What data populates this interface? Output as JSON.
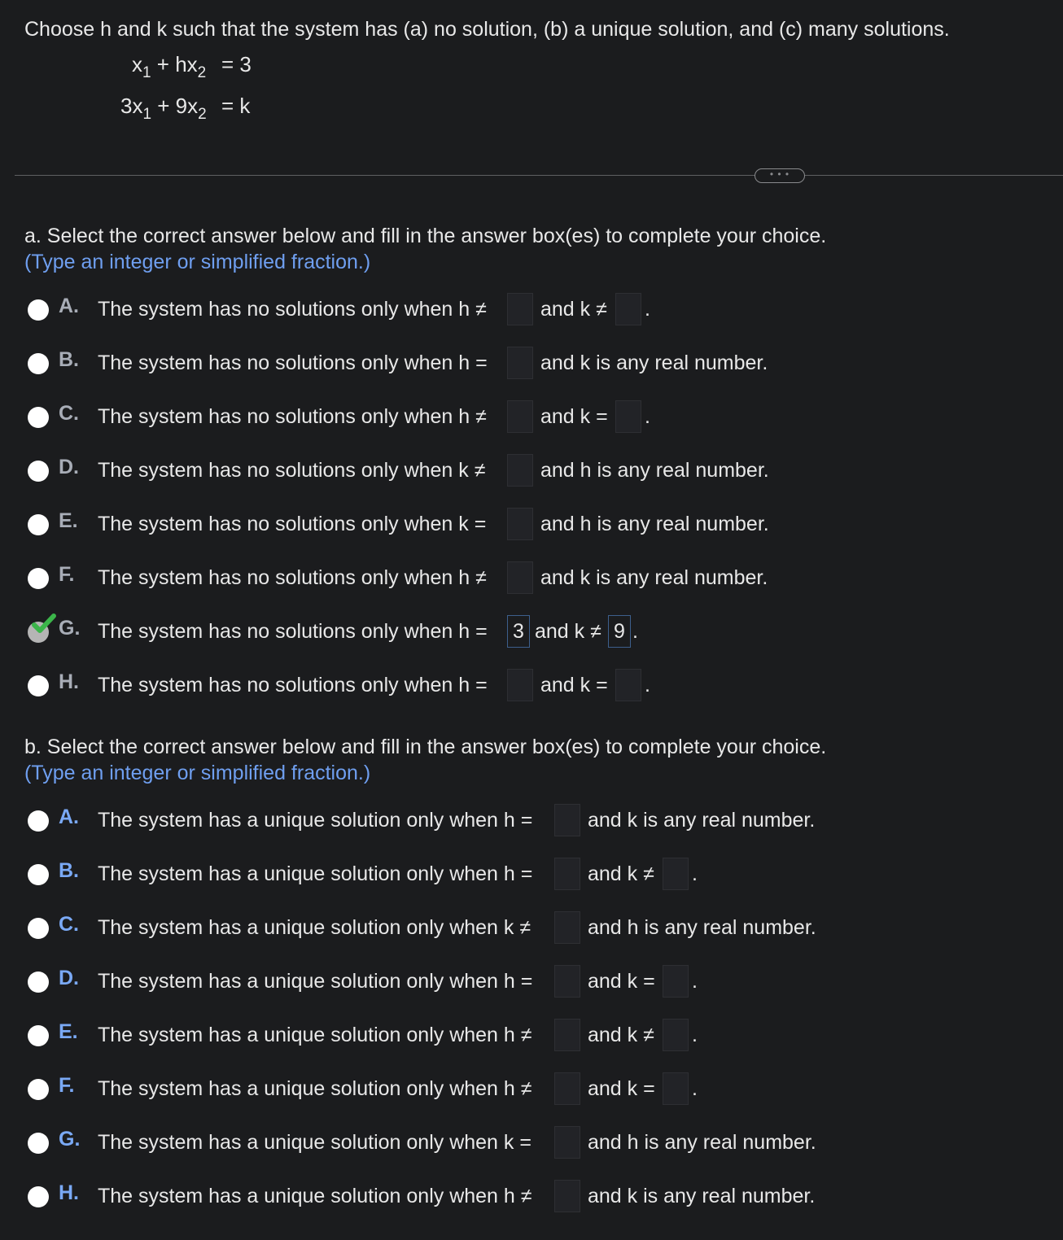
{
  "question": {
    "prompt": "Choose h and k such that the system has (a) no solution, (b) a unique solution, and (c) many solutions.",
    "eq1": {
      "lhs_a": "x",
      "sub_a": "1",
      "lhs_b": " + hx",
      "sub_b": "2",
      "rel": "=  3"
    },
    "eq2": {
      "lhs_a": "3x",
      "sub_a": "1",
      "lhs_b": " + 9x",
      "sub_b": "2",
      "rel": "=  k"
    },
    "more_label": "• • •"
  },
  "part_a": {
    "title": "a. Select the correct answer below and fill in the answer box(es) to complete your choice.",
    "hint": "(Type an integer or simplified fraction.)",
    "options": [
      {
        "letter": "A.",
        "text1": "The system has no solutions only when h ≠",
        "text2": "and k ≠",
        "box1": "",
        "box2": "",
        "end": "."
      },
      {
        "letter": "B.",
        "text1": "The system has no solutions only when h =",
        "text2": "and k is any real number.",
        "box1": ""
      },
      {
        "letter": "C.",
        "text1": "The system has no solutions only when h ≠",
        "text2": "and k =",
        "box1": "",
        "box2": "",
        "end": "."
      },
      {
        "letter": "D.",
        "text1": "The system has no solutions only when k ≠",
        "text2": "and h is any real number.",
        "box1": ""
      },
      {
        "letter": "E.",
        "text1": "The system has no solutions only when k =",
        "text2": "and h is any real number.",
        "box1": ""
      },
      {
        "letter": "F.",
        "text1": "The system has no solutions only when h ≠",
        "text2": "and k is any real number.",
        "box1": ""
      },
      {
        "letter": "G.",
        "text1": "The system has no solutions only when h =",
        "text2": "and k ≠",
        "box1": "3",
        "box2": "9",
        "end": ".",
        "selected": true
      },
      {
        "letter": "H.",
        "text1": "The system has no solutions only when h =",
        "text2": "and k =",
        "box1": "",
        "box2": "",
        "end": "."
      }
    ]
  },
  "part_b": {
    "title": "b. Select the correct answer below and fill in the answer box(es) to complete your choice.",
    "hint": "(Type an integer or simplified fraction.)",
    "options": [
      {
        "letter": "A.",
        "text1": "The system has a unique solution only when h =",
        "text2": "and k is any real number.",
        "box1": ""
      },
      {
        "letter": "B.",
        "text1": "The system has a unique solution only when h =",
        "text2": "and k ≠",
        "box1": "",
        "box2": "",
        "end": "."
      },
      {
        "letter": "C.",
        "text1": "The system has a unique solution only when k ≠",
        "text2": "and h is any real number.",
        "box1": ""
      },
      {
        "letter": "D.",
        "text1": "The system has a unique solution only when h =",
        "text2": "and k =",
        "box1": "",
        "box2": "",
        "end": "."
      },
      {
        "letter": "E.",
        "text1": "The system has a unique solution only when h ≠",
        "text2": "and k ≠",
        "box1": "",
        "box2": "",
        "end": "."
      },
      {
        "letter": "F.",
        "text1": "The system has a unique solution only when h ≠",
        "text2": "and k =",
        "box1": "",
        "box2": "",
        "end": "."
      },
      {
        "letter": "G.",
        "text1": "The system has a unique solution only when k =",
        "text2": "and h is any real number.",
        "box1": ""
      },
      {
        "letter": "H.",
        "text1": "The system has a unique solution only when h ≠",
        "text2": "and k is any real number.",
        "box1": ""
      }
    ]
  },
  "colors": {
    "background": "#1b1c1e",
    "hint": "#6f9ff0",
    "letter_b": "#7aa9f5",
    "check": "#3bb54a"
  }
}
